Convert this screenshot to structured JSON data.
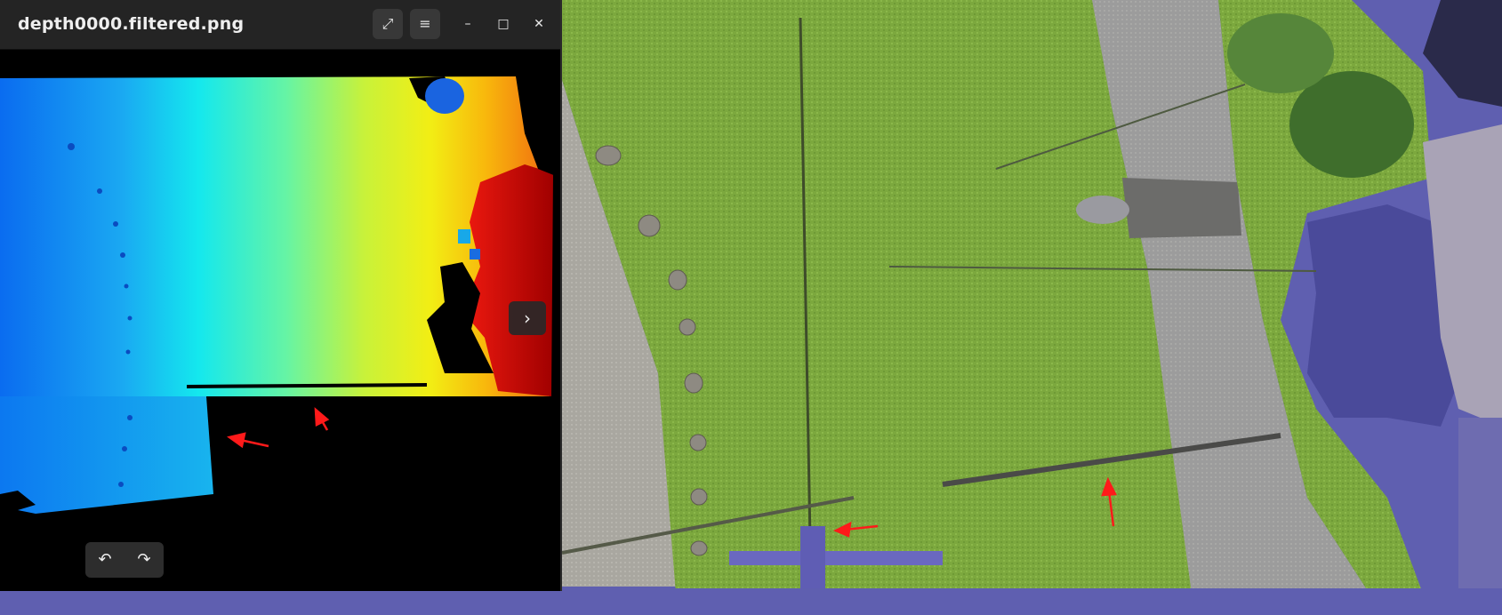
{
  "viewer": {
    "title": "depth0000.filtered.png",
    "header_buttons": {
      "fullscreen_icon": "⤢",
      "menu_icon": "≡",
      "minimize_icon": "–",
      "maximize_icon": "□",
      "close_icon": "✕"
    },
    "nav_next_icon": "›",
    "rotate_left_icon": "↶",
    "rotate_right_icon": "↷"
  },
  "colors": {
    "titlebar": "#242424",
    "annotation_arrow": "#ff1a1a",
    "cloud_background": "#5f5fb0",
    "grass": "#7aa53d",
    "road": "#9a9a9a"
  }
}
